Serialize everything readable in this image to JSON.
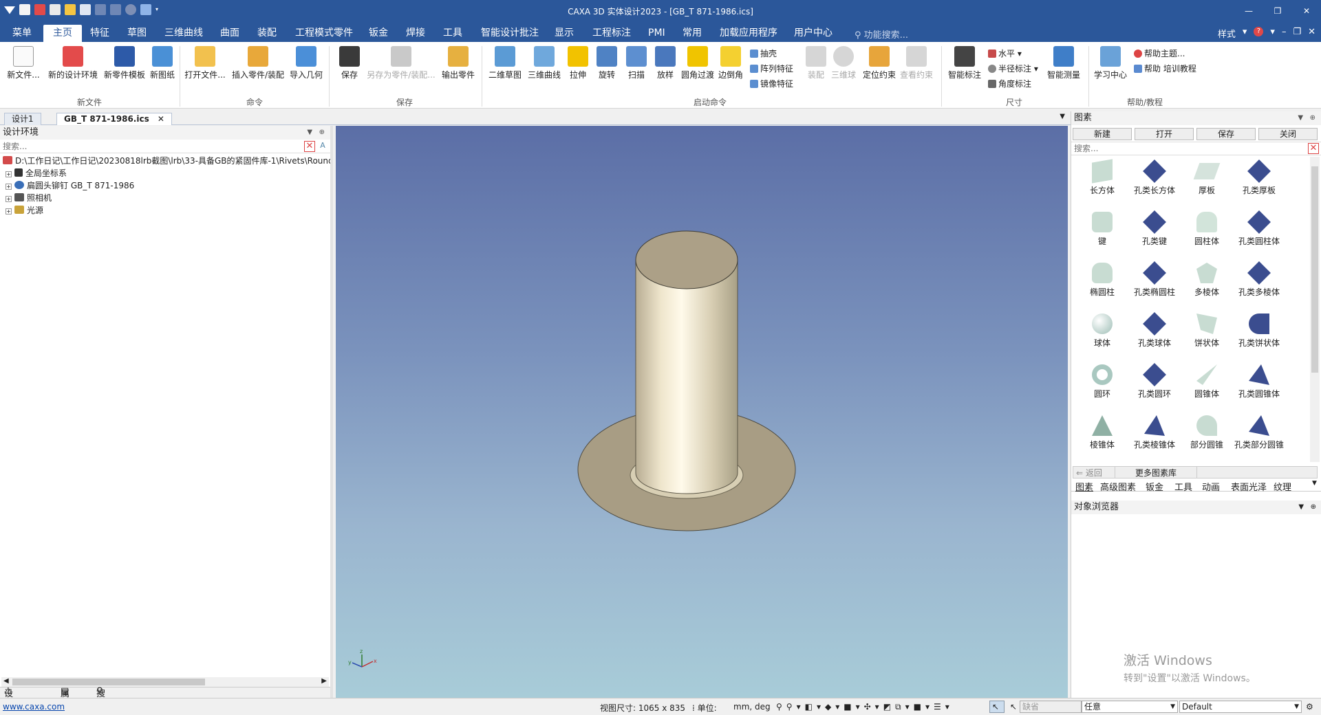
{
  "window": {
    "title": "CAXA 3D 实体设计2023 - [GB_T 871-1986.ics]"
  },
  "menu": {
    "tabs": [
      "菜单",
      "主页",
      "特征",
      "草图",
      "三维曲线",
      "曲面",
      "装配",
      "工程模式零件",
      "钣金",
      "焊接",
      "工具",
      "智能设计批注",
      "显示",
      "工程标注",
      "PMI",
      "常用",
      "加载应用程序",
      "用户中心"
    ],
    "active": "主页",
    "search_placeholder": "功能搜索...",
    "style_label": "样式"
  },
  "ribbon": {
    "new_file": "新文件...",
    "new_design_env": "新的设计环境",
    "new_part_template": "新零件模板",
    "new_drawing": "新图纸",
    "group_new": "新文件",
    "open_file": "打开文件...",
    "insert_part": "插入零件/装配",
    "import_geometry": "导入几何",
    "group_command": "命令",
    "save": "保存",
    "save_as_part": "另存为零件/装配...",
    "export_part": "输出零件",
    "group_save": "保存",
    "sketch2d": "二维草图",
    "curve3d": "三维曲线",
    "extrude": "拉伸",
    "revolve": "旋转",
    "sweep": "扫描",
    "loft": "放样",
    "fillet": "圆角过渡",
    "chamfer": "边倒角",
    "shell": "抽壳",
    "pattern": "阵列特征",
    "mirror": "镜像特征",
    "assemble": "装配",
    "ball3d": "三维球",
    "position_constraint": "定位约束",
    "view_constraint": "查看约束",
    "group_launch": "启动命令",
    "smart_dim": "智能标注",
    "horizontal": "水平",
    "radius_dim": "半径标注",
    "angle_dim": "角度标注",
    "smart_measure": "智能测量",
    "group_dim": "尺寸",
    "learning": "学习中心",
    "help_topics": "帮助主题...",
    "help_training": "帮助 培训教程",
    "group_help": "帮助/教程"
  },
  "doc_tabs": [
    "设计1",
    "GB_T 871-1986.ics"
  ],
  "left_panel": {
    "title": "设计环境",
    "search_placeholder": "搜索...",
    "tree": [
      "D:\\工作日记\\工作日记\\20230818lrb截图\\lrb\\33-具备GB的紧固件库-1\\Rivets\\Round",
      "全局坐标系",
      "扁圆头铆钉 GB_T 871-1986",
      "照相机",
      "光源"
    ],
    "bottom_tabs": [
      "设计环境",
      "属性",
      "搜索"
    ]
  },
  "right_panel": {
    "title": "图素",
    "buttons": [
      "新建",
      "打开",
      "保存",
      "关闭"
    ],
    "search_placeholder": "搜索...",
    "items": [
      "长方体",
      "孔类长方体",
      "厚板",
      "孔类厚板",
      "键",
      "孔类键",
      "圆柱体",
      "孔类圆柱体",
      "椭圆柱",
      "孔类椭圆柱",
      "多棱体",
      "孔类多棱体",
      "球体",
      "孔类球体",
      "饼状体",
      "孔类饼状体",
      "圆环",
      "孔类圆环",
      "圆锥体",
      "孔类圆锥体",
      "棱锥体",
      "孔类棱锥体",
      "部分圆锥",
      "孔类部分圆锥"
    ],
    "back": "返回",
    "more": "更多图素库",
    "tabs": [
      "图素",
      "高级图素",
      "钣金",
      "工具",
      "动画",
      "表面光泽",
      "纹理"
    ],
    "object_browser": "对象浏览器",
    "watermark_1": "激活 Windows",
    "watermark_2": "转到\"设置\"以激活 Windows。"
  },
  "status": {
    "link": "www.caxa.com",
    "view_size": "视图尺寸: 1065 x  835",
    "unit_label": "单位:",
    "unit_value": "mm, deg",
    "default_field": "缺省",
    "any_field": "任意",
    "render_field": "Default"
  },
  "colors": {
    "titlebar": "#2b579a",
    "viewport_top": "#5b6ea6",
    "viewport_bottom": "#a8ccd8"
  }
}
